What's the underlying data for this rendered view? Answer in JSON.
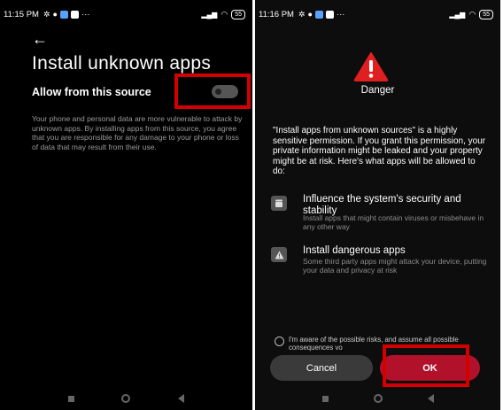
{
  "left_screen": {
    "status": {
      "time": "11:15 PM",
      "more": "···",
      "battery": "55"
    },
    "title": "Install unknown apps",
    "allow_label": "Allow from this source",
    "toggle_on": false,
    "description": "Your phone and personal data are more vulnerable to attack by unknown apps. By installing apps from this source, you agree that you are responsible for any damage to your phone or loss of data that may result from their use."
  },
  "right_screen": {
    "status": {
      "time": "11:16 PM",
      "more": "···",
      "battery": "55"
    },
    "danger_label": "Danger",
    "warning": "\"Install apps from unknown sources\" is a highly sensitive permission. If you grant this permission, your private information might be leaked and your property might be at risk. Here's what apps will be allowed to do:",
    "items": [
      {
        "title": "Influence the system's security and stability",
        "subtitle": "Install apps that might contain viruses or misbehave in any other way",
        "icon": "android-icon"
      },
      {
        "title": "Install dangerous apps",
        "subtitle": "Some third party apps might attack your device, putting your data and privacy at risk",
        "icon": "warning-icon"
      }
    ],
    "consent": "I'm aware of the possible risks, and assume all possible consequences vo",
    "cancel_label": "Cancel",
    "ok_label": "OK"
  },
  "colors": {
    "highlight": "#d40000",
    "ok_button": "#b1112a",
    "danger": "#e02020"
  }
}
